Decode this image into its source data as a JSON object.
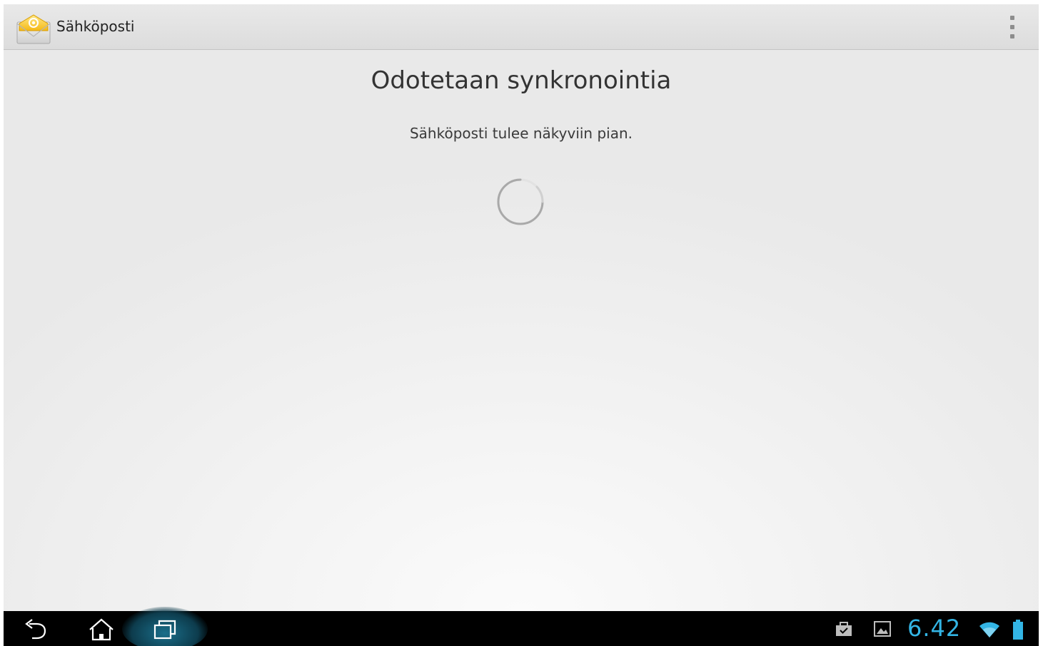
{
  "action_bar": {
    "title": "Sähköposti",
    "app_icon": "email-envelope-icon",
    "overflow_icon": "overflow-menu-icon"
  },
  "content": {
    "title": "Odotetaan synkronointia",
    "message": "Sähköposti tulee näkyviin pian.",
    "spinner_icon": "loading-spinner-icon"
  },
  "system_bar": {
    "back_icon": "back-icon",
    "home_icon": "home-icon",
    "recents_icon": "recent-apps-icon",
    "notification_icons": [
      "briefcase-icon",
      "image-icon"
    ],
    "clock": "6.42",
    "wifi_icon": "wifi-icon",
    "battery_icon": "battery-icon"
  },
  "colors": {
    "accent": "#33b5e5",
    "action_bar": "#e2e2e2",
    "nav_bar": "#000000",
    "background": "#ececec"
  }
}
